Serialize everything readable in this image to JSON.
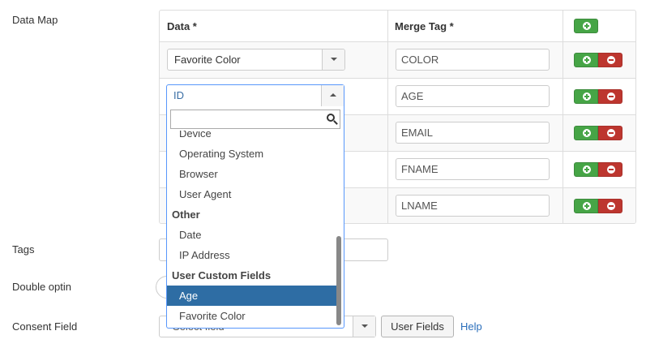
{
  "labels": {
    "data_map": "Data Map",
    "tags": "Tags",
    "double_optin": "Double optin",
    "consent_field": "Consent Field"
  },
  "table": {
    "headers": {
      "data": "Data *",
      "merge_tag": "Merge Tag *"
    },
    "rows": [
      {
        "data": "Favorite Color",
        "merge_tag": "COLOR"
      },
      {
        "data": "ID",
        "merge_tag": "AGE"
      },
      {
        "data": "",
        "merge_tag": "EMAIL"
      },
      {
        "data": "",
        "merge_tag": "FNAME"
      },
      {
        "data": "",
        "merge_tag": "LNAME"
      }
    ]
  },
  "dropdown": {
    "search_value": "",
    "items": [
      {
        "type": "option",
        "label": "Device"
      },
      {
        "type": "option",
        "label": "Operating System"
      },
      {
        "type": "option",
        "label": "Browser"
      },
      {
        "type": "option",
        "label": "User Agent"
      },
      {
        "type": "group",
        "label": "Other"
      },
      {
        "type": "option",
        "label": "Date"
      },
      {
        "type": "option",
        "label": "IP Address"
      },
      {
        "type": "group",
        "label": "User Custom Fields"
      },
      {
        "type": "option",
        "label": "Age",
        "highlighted": true
      },
      {
        "type": "option",
        "label": "Favorite Color"
      }
    ]
  },
  "consent": {
    "select_value": "Select field",
    "user_fields_button": "User Fields",
    "help_link": "Help"
  },
  "colors": {
    "add_button": "#46a546",
    "remove_button": "#bd362f",
    "highlight": "#2e6da4",
    "link": "#2a6ebb"
  },
  "icons": {
    "add": "plus-circle-icon",
    "remove": "minus-circle-icon",
    "search": "search-icon",
    "dropdown": "caret-down-icon"
  }
}
